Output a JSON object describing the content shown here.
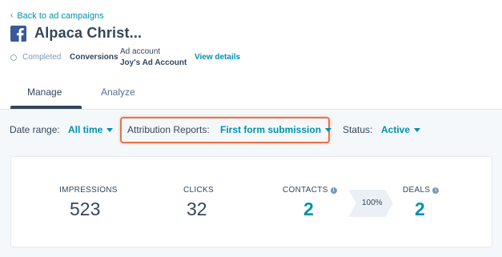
{
  "header": {
    "back_link": "Back to ad campaigns",
    "title": "Alpaca Christ...",
    "status": "Completed",
    "goal": "Conversions",
    "ad_account_label": "Ad account",
    "ad_account_value": "Joy's Ad Account",
    "view_details": "View details"
  },
  "tabs": [
    {
      "label": "Manage",
      "active": true
    },
    {
      "label": "Analyze",
      "active": false
    }
  ],
  "filters": {
    "date_range_label": "Date range:",
    "date_range_value": "All time",
    "attribution_label": "Attribution Reports:",
    "attribution_value": "First form submission",
    "status_label": "Status:",
    "status_value": "Active"
  },
  "stats": {
    "impressions_label": "IMPRESSIONS",
    "impressions_value": "523",
    "clicks_label": "CLICKS",
    "clicks_value": "32",
    "contacts_label": "CONTACTS",
    "contacts_value": "2",
    "conversion_rate": "100%",
    "deals_label": "DEALS",
    "deals_value": "2"
  },
  "colors": {
    "accent": "#0091ae",
    "text": "#33475b",
    "highlight": "#e8734a",
    "facebook": "#3b5998"
  }
}
